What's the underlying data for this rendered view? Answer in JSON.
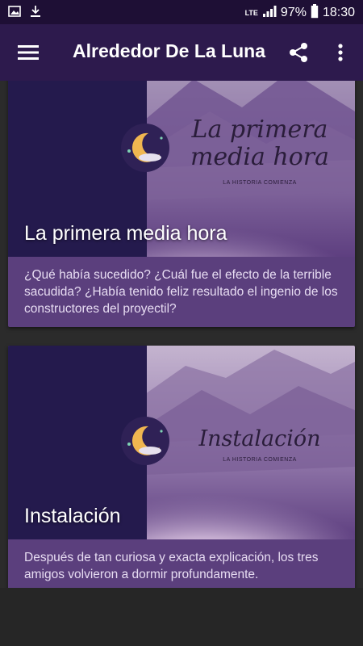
{
  "status_bar": {
    "network": "LTE",
    "battery": "97%",
    "time": "18:30"
  },
  "app_bar": {
    "title": "Alrededor De La Luna"
  },
  "cards": [
    {
      "title": "La primera media hora",
      "art_title_line1": "La primera",
      "art_title_line2": "media hora",
      "art_subtitle": "LA HISTORIA COMIENZA",
      "description": "¿Qué había sucedido? ¿Cuál fue el efecto de la terrible sacudida? ¿Había tenido feliz resultado el ingenio de los constructores del proyectil?"
    },
    {
      "title": "Instalación",
      "art_title_line1": "Instalación",
      "art_subtitle": "LA HISTORIA COMIENZA",
      "description": "Después de tan curiosa y exacta explicación, los tres amigos volvieron a dormir profundamente."
    }
  ],
  "colors": {
    "status_bar": "#1e0f35",
    "app_bar": "#2d1a4d",
    "card_body": "#5b3f7d",
    "card_left_panel": "#241a4d",
    "moon": "#f0b650"
  },
  "icons": [
    "image-icon",
    "download-icon",
    "signal-icon",
    "battery-icon",
    "menu-icon",
    "share-icon",
    "more-vert-icon",
    "moon-logo-icon"
  ]
}
